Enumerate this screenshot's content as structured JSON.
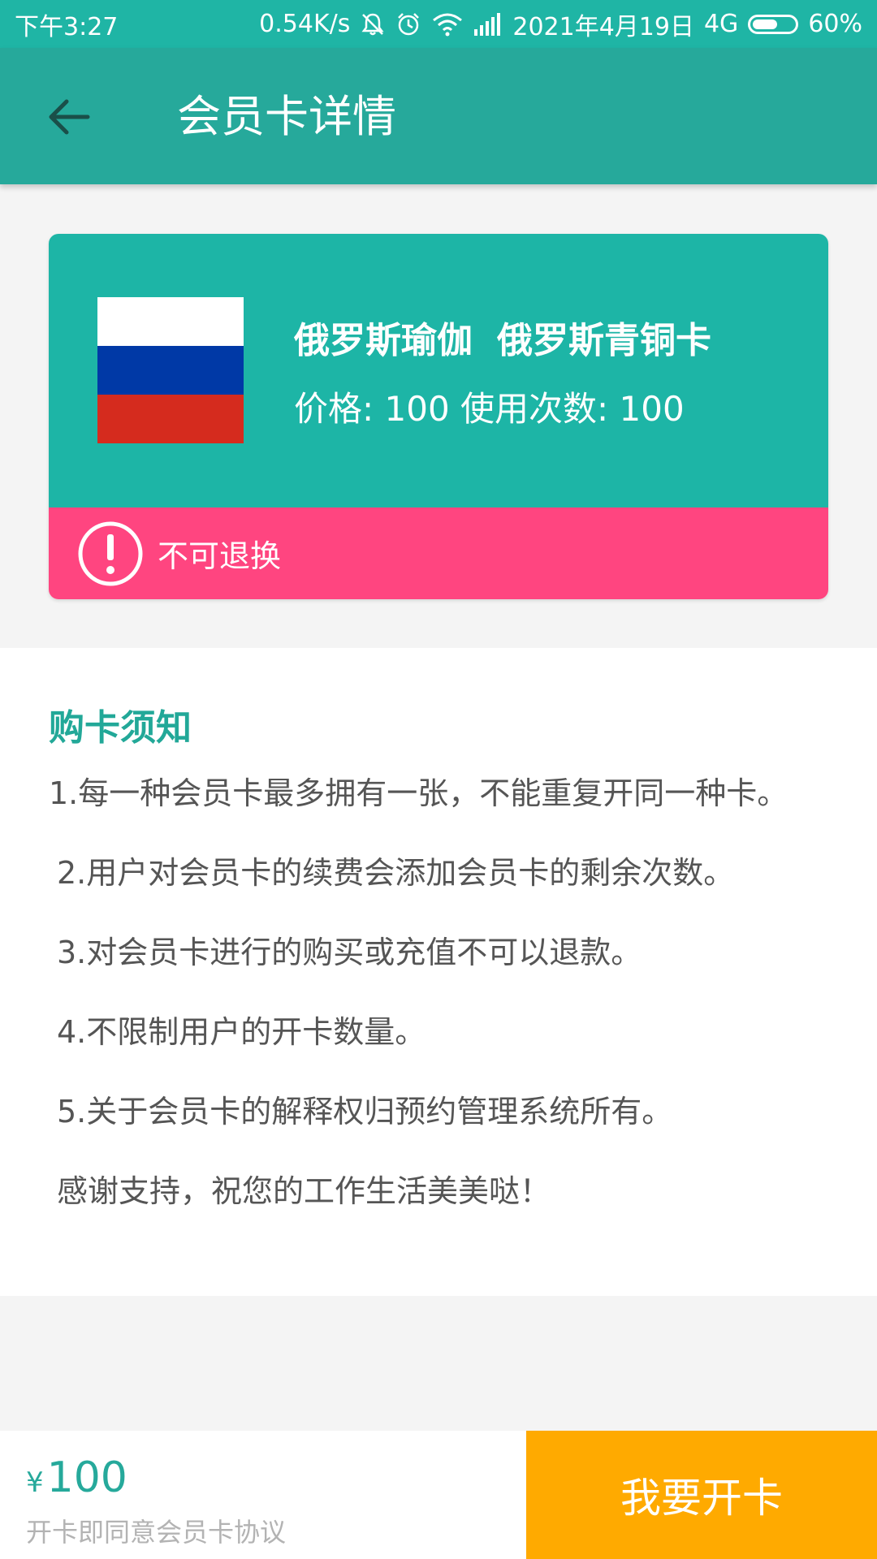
{
  "status_bar": {
    "time": "下午3:27",
    "speed": "0.54K/s",
    "date": "2021年4月19日",
    "network": "4G",
    "battery": "60%",
    "icons": [
      "mute-bell-icon",
      "alarm-icon",
      "wifi-icon",
      "signal-icon",
      "battery-icon"
    ]
  },
  "toolbar": {
    "title": "会员卡详情",
    "back_icon": "arrow-left-icon"
  },
  "card": {
    "name": "俄罗斯瑜伽",
    "type": "俄罗斯青铜卡",
    "price_line": "价格: 100 使用次数: 100",
    "warning": "不可退换",
    "flag_colors": [
      "#ffffff",
      "#0039a6",
      "#d52b1e"
    ],
    "colors": {
      "top": "#1db5a6",
      "bottom": "#ff4580"
    }
  },
  "notice": {
    "title": "购卡须知",
    "items": [
      "1.每一种会员卡最多拥有一张，不能重复开同一种卡。",
      "2.用户对会员卡的续费会添加会员卡的剩余次数。",
      "3.对会员卡进行的购买或充值不可以退款。",
      "4.不限制用户的开卡数量。",
      "5.关于会员卡的解释权归预约管理系统所有。",
      "感谢支持，祝您的工作生活美美哒！"
    ]
  },
  "bottom_bar": {
    "currency": "¥",
    "price": "100",
    "agreement": "开卡即同意会员卡协议",
    "button_label": "我要开卡",
    "colors": {
      "button": "#ffaa00",
      "price": "#26a99b"
    }
  }
}
